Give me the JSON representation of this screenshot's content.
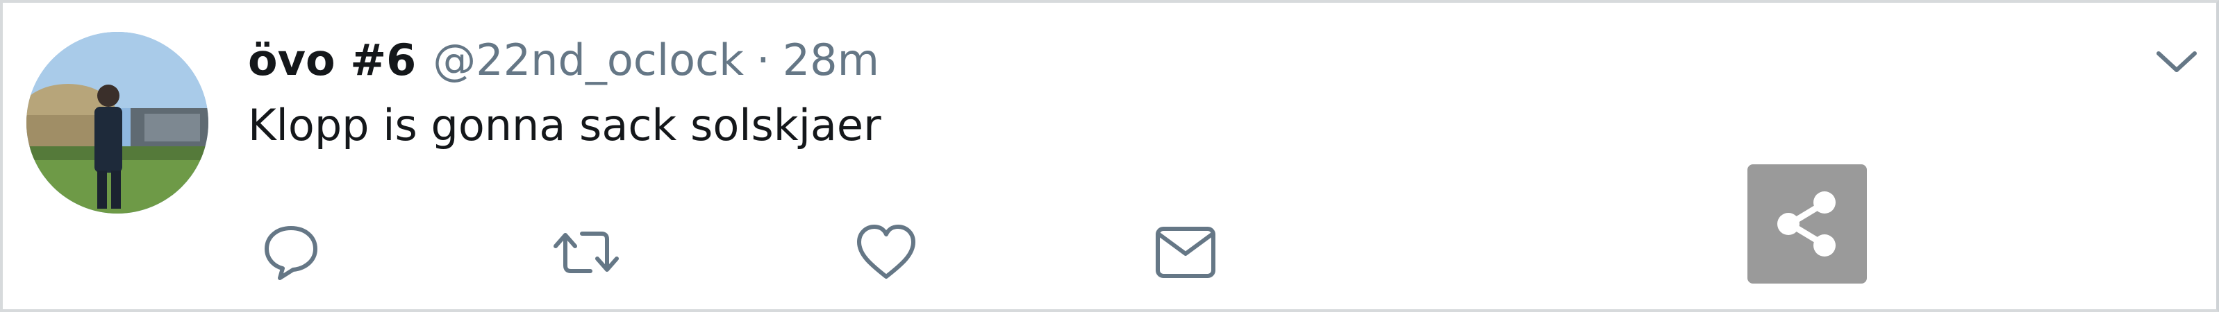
{
  "tweet": {
    "display_name": "övo #6",
    "handle": "@22nd_oclock",
    "separator": "·",
    "timestamp": "28m",
    "text": "Klopp is gonna sack solskjaer"
  },
  "icons": {
    "caret": "chevron-down-icon",
    "reply": "reply-icon",
    "retweet": "retweet-icon",
    "like": "heart-icon",
    "message": "envelope-icon",
    "share": "share-icon"
  },
  "colors": {
    "text_primary": "#14171a",
    "text_secondary": "#657786",
    "icon": "#657786",
    "share_bg": "#9a9a9a",
    "share_fg": "#ffffff"
  }
}
